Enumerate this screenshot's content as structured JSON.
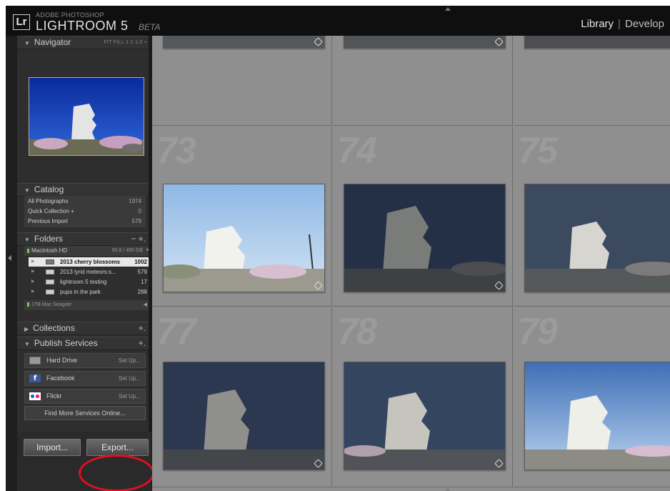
{
  "app": {
    "logo_text": "Lr",
    "brand_small": "ADOBE PHOTOSHOP",
    "brand_name": "LIGHTROOM 5",
    "brand_beta": "BETA"
  },
  "modules": {
    "library": "Library",
    "separator": "|",
    "develop": "Develop"
  },
  "navigator": {
    "title": "Navigator",
    "options": "FIT  FILL  1:1  1:2 ÷"
  },
  "catalog": {
    "title": "Catalog",
    "items": [
      {
        "label": "All Photographs",
        "count": "1974"
      },
      {
        "label": "Quick Collection  +",
        "count": "0"
      },
      {
        "label": "Previous Import",
        "count": "579"
      }
    ]
  },
  "folders": {
    "title": "Folders",
    "actions": "−  +.",
    "drive": {
      "name": "Macintosh HD",
      "size": "60.6 / 465 GB"
    },
    "items": [
      {
        "label": "2013 cherry blossoms",
        "count": "1002",
        "selected": true
      },
      {
        "label": "2013 lyrid meteors:s...",
        "count": "579",
        "selected": false
      },
      {
        "label": "lightroom 5 testing",
        "count": "17",
        "selected": false
      },
      {
        "label": "pups in the park",
        "count": "288",
        "selected": false
      }
    ],
    "drive2": {
      "name": "1TB Mac Seagate"
    }
  },
  "collections": {
    "title": "Collections",
    "action": "+."
  },
  "publish": {
    "title": "Publish Services",
    "action": "+.",
    "items": [
      {
        "label": "Hard Drive",
        "action": "Set Up...",
        "icon": "hard-drive-icon"
      },
      {
        "label": "Facebook",
        "action": "Set Up...",
        "icon": "facebook-icon"
      },
      {
        "label": "Flickr",
        "action": "Set Up...",
        "icon": "flickr-icon"
      }
    ],
    "find_more": "Find More Services Online..."
  },
  "buttons": {
    "import": "Import...",
    "export": "Export..."
  },
  "grid": {
    "cell_numbers": [
      "73",
      "74",
      "75",
      "77",
      "78",
      "79"
    ]
  },
  "colors": {
    "highlight_circle": "#e01020",
    "grid_bg": "#8e8e8e",
    "panel_bg": "#2e2e2e"
  }
}
